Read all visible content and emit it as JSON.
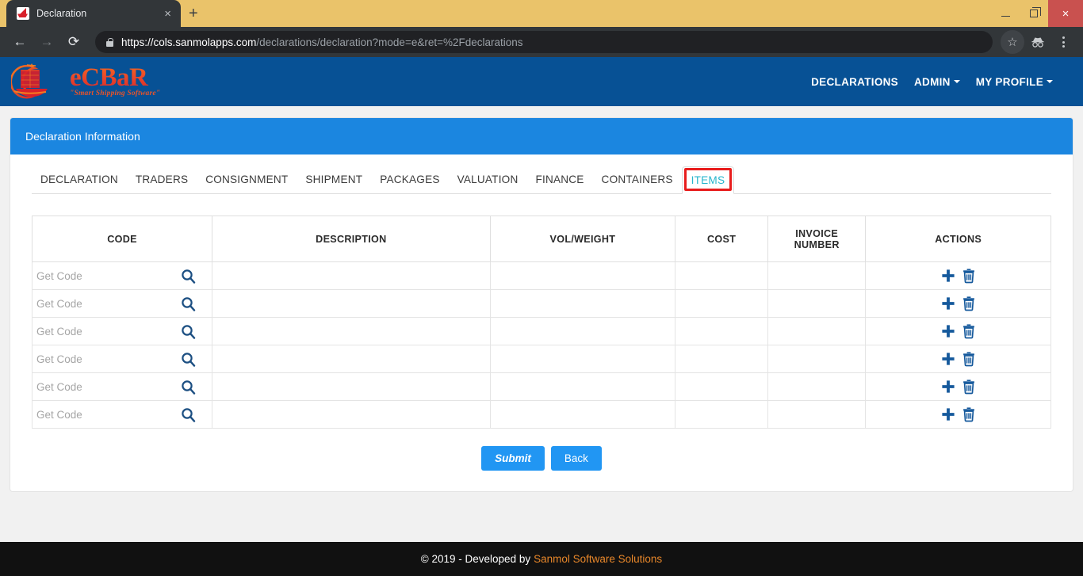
{
  "browser": {
    "tab": {
      "title": "Declaration",
      "favicon": "ship-favicon",
      "close_label": "×"
    },
    "new_tab_label": "+",
    "window_controls": {
      "minimize": "minimize-icon",
      "maximize": "maximize-icon",
      "close": "×"
    },
    "nav": {
      "back": "←",
      "forward": "→",
      "reload": "⟳"
    },
    "omnibox": {
      "security_icon": "lock-icon",
      "url_scheme_host": "https://cols.sanmolapps.com",
      "url_path": "/declarations/declaration?mode=e&ret=%2Fdeclarations",
      "full_url": "https://cols.sanmolapps.com/declarations/declaration?mode=e&ret=%2Fdeclarations"
    },
    "toolbar_icons": {
      "bookmark": "☆",
      "incognito": "incognito-icon",
      "menu": "kebab-menu-icon"
    }
  },
  "app": {
    "brand": {
      "name": "eCBaR",
      "tagline": "\"Smart Shipping Software\"",
      "mark": "ship-logo"
    },
    "navlinks": [
      {
        "label": "DECLARATIONS",
        "has_caret": false
      },
      {
        "label": "ADMIN",
        "has_caret": true
      },
      {
        "label": "MY PROFILE",
        "has_caret": true
      }
    ]
  },
  "panel": {
    "title": "Declaration Information",
    "tabs": [
      {
        "label": "DECLARATION",
        "active": false
      },
      {
        "label": "TRADERS",
        "active": false
      },
      {
        "label": "CONSIGNMENT",
        "active": false
      },
      {
        "label": "SHIPMENT",
        "active": false
      },
      {
        "label": "PACKAGES",
        "active": false
      },
      {
        "label": "VALUATION",
        "active": false
      },
      {
        "label": "FINANCE",
        "active": false
      },
      {
        "label": "CONTAINERS",
        "active": false
      },
      {
        "label": "ITEMS",
        "active": true
      }
    ],
    "table": {
      "columns": [
        "CODE",
        "DESCRIPTION",
        "VOL/WEIGHT",
        "COST",
        "INVOICE NUMBER",
        "ACTIONS"
      ],
      "invoice_header_line1": "INVOICE",
      "invoice_header_line2": "NUMBER",
      "code_placeholder": "Get Code",
      "row_icons": {
        "search": "search-icon",
        "add": "plus-icon",
        "delete": "trash-icon"
      },
      "rows": [
        {
          "code": "",
          "description": "",
          "vol_weight": "",
          "cost": "",
          "invoice_number": ""
        },
        {
          "code": "",
          "description": "",
          "vol_weight": "",
          "cost": "",
          "invoice_number": ""
        },
        {
          "code": "",
          "description": "",
          "vol_weight": "",
          "cost": "",
          "invoice_number": ""
        },
        {
          "code": "",
          "description": "",
          "vol_weight": "",
          "cost": "",
          "invoice_number": ""
        },
        {
          "code": "",
          "description": "",
          "vol_weight": "",
          "cost": "",
          "invoice_number": ""
        },
        {
          "code": "",
          "description": "",
          "vol_weight": "",
          "cost": "",
          "invoice_number": ""
        }
      ]
    },
    "buttons": {
      "submit": "Submit",
      "back": "Back"
    }
  },
  "footer": {
    "copyright": "© 2019 - Developed by",
    "company": "Sanmol Software Solutions"
  },
  "colors": {
    "navbar": "#075195",
    "panel_header": "#1b86e0",
    "button": "#2196f3",
    "active_tab_text": "#27b5cc",
    "annotation": "#e81c1c",
    "footer_link": "#e8872a",
    "titlebar": "#eac36a",
    "chrome_dark": "#323639"
  }
}
